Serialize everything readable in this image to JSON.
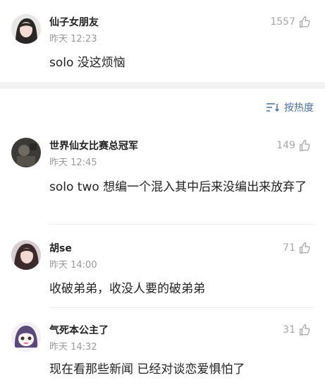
{
  "sort": {
    "label": "按热度",
    "icon": "sort-icon",
    "color": "#4a6f9e"
  },
  "comments": [
    {
      "username": "仙子女朋友",
      "time": "昨天 12:23",
      "likes": "1557",
      "text": "solo 没这烦恼",
      "avatar_icon": "girl-avatar"
    },
    {
      "username": "世界仙女比赛总冠军",
      "time": "昨天 12:45",
      "likes": "149",
      "text": "solo two 想编一个混入其中后来没编出来放弃了",
      "avatar_icon": "dark-photo-avatar"
    },
    {
      "username": "胡se",
      "time": "昨天 14:00",
      "likes": "71",
      "text": "收破弟弟，收没人要的破弟弟",
      "avatar_icon": "girl-avatar"
    },
    {
      "username": "气死本公主了",
      "time": "昨天 14:32",
      "likes": "31",
      "text": "现在看那些新闻 已经对谈恋爱惧怕了",
      "avatar_icon": "anime-girl-avatar"
    }
  ]
}
